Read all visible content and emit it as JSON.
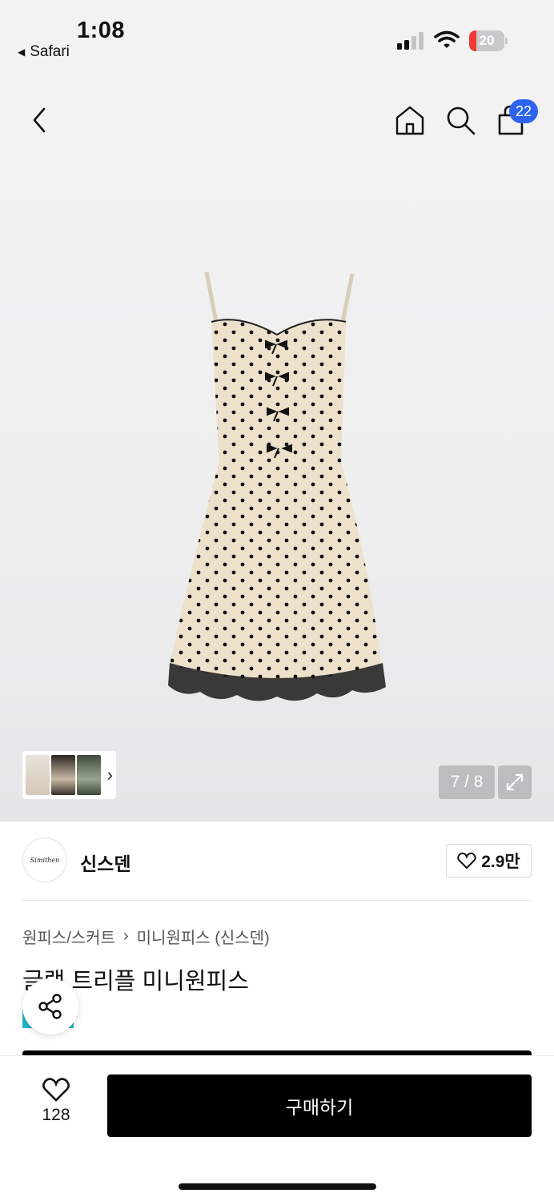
{
  "status_bar": {
    "time": "1:08",
    "back_app": "Safari",
    "battery_percent": "20",
    "battery_level": 0.2,
    "icons": [
      "signal-icon",
      "wifi-icon",
      "battery-icon"
    ]
  },
  "nav": {
    "cart_badge": "22",
    "icons": [
      "back-chevron-icon",
      "home-icon",
      "search-icon",
      "shopping-bag-icon"
    ]
  },
  "gallery": {
    "counter": "7 / 8",
    "icons": [
      "expand-icon",
      "chevron-right-icon"
    ]
  },
  "brand": {
    "logo_text": "Simithen",
    "name": "신스덴",
    "likes": "2.9만"
  },
  "product": {
    "breadcrumb": [
      "원피스/스커트",
      "미니원피스 (신스덴)"
    ],
    "title": "글램 트리플 미니원피스"
  },
  "bottom_bar": {
    "wish_count": "128",
    "buy_label": "구매하기"
  },
  "colors": {
    "accent_blue": "#2c64f0",
    "battery_red": "#ef3b34",
    "teal_tag": "#20b6c8",
    "buy_button": "#000000"
  }
}
